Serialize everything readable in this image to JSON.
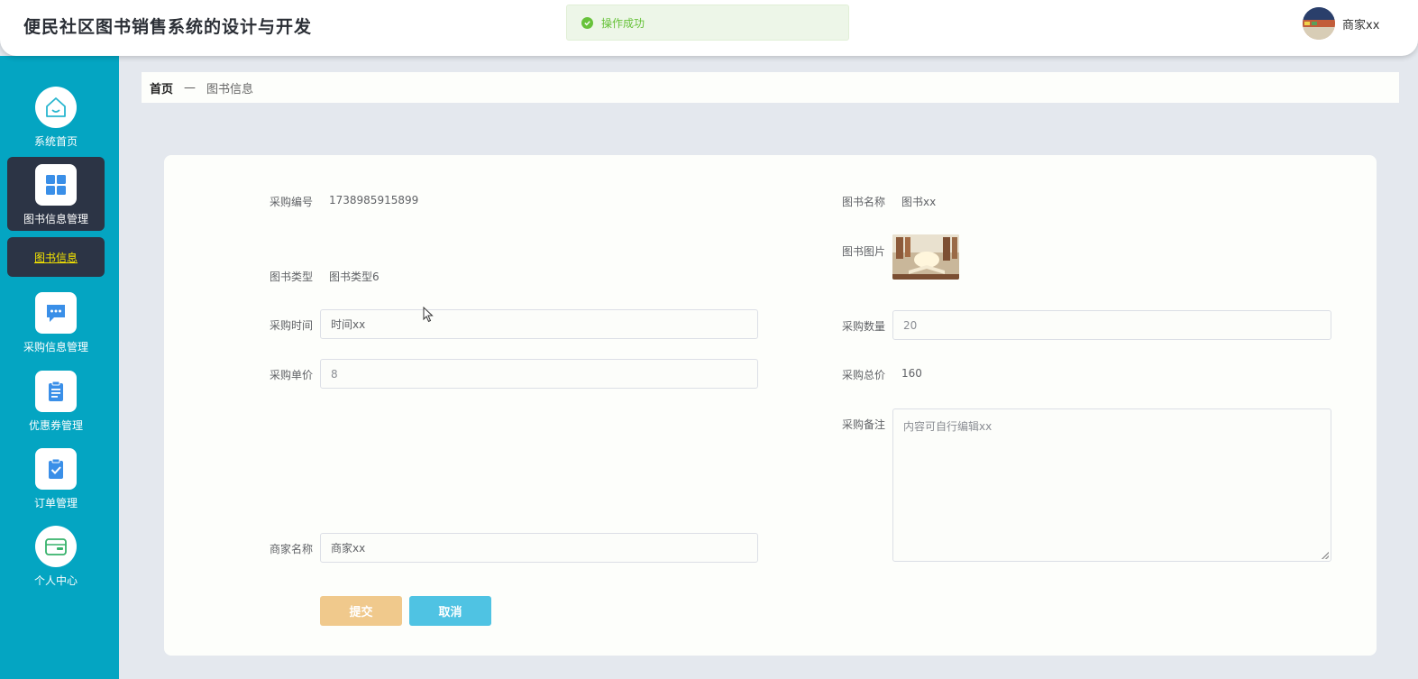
{
  "header": {
    "title": "便民社区图书销售系统的设计与开发",
    "toast": "操作成功",
    "username": "商家xx"
  },
  "sidebar": {
    "items": [
      {
        "label": "系统首页",
        "icon": "home-icon"
      },
      {
        "label": "图书信息管理",
        "icon": "grid-icon"
      },
      {
        "label": "采购信息管理",
        "icon": "chat-icon"
      },
      {
        "label": "优惠券管理",
        "icon": "clipboard-icon"
      },
      {
        "label": "订单管理",
        "icon": "checklist-icon"
      },
      {
        "label": "个人中心",
        "icon": "wallet-icon"
      }
    ],
    "sub_item": "图书信息"
  },
  "breadcrumb": {
    "home": "首页",
    "separator": "—",
    "current": "图书信息"
  },
  "form": {
    "purchase_no": {
      "label": "采购编号",
      "value": "1738985915899"
    },
    "book_name": {
      "label": "图书名称",
      "value": "图书xx"
    },
    "book_image": {
      "label": "图书图片"
    },
    "book_type": {
      "label": "图书类型",
      "value": "图书类型6"
    },
    "purchase_time": {
      "label": "采购时间",
      "value": "时间xx"
    },
    "purchase_qty": {
      "label": "采购数量",
      "value": "20"
    },
    "unit_price": {
      "label": "采购单价",
      "value": "8"
    },
    "total_price": {
      "label": "采购总价",
      "value": "160"
    },
    "remark": {
      "label": "采购备注",
      "value": "内容可自行编辑xx"
    },
    "merchant_name": {
      "label": "商家名称",
      "value": "商家xx"
    }
  },
  "buttons": {
    "submit": "提交",
    "cancel": "取消"
  },
  "colors": {
    "sidebar": "#04a5c2",
    "sidebar_active": "#2c3445",
    "submit": "#f0c98c",
    "cancel": "#4fc3e3",
    "success": "#67c23a"
  }
}
